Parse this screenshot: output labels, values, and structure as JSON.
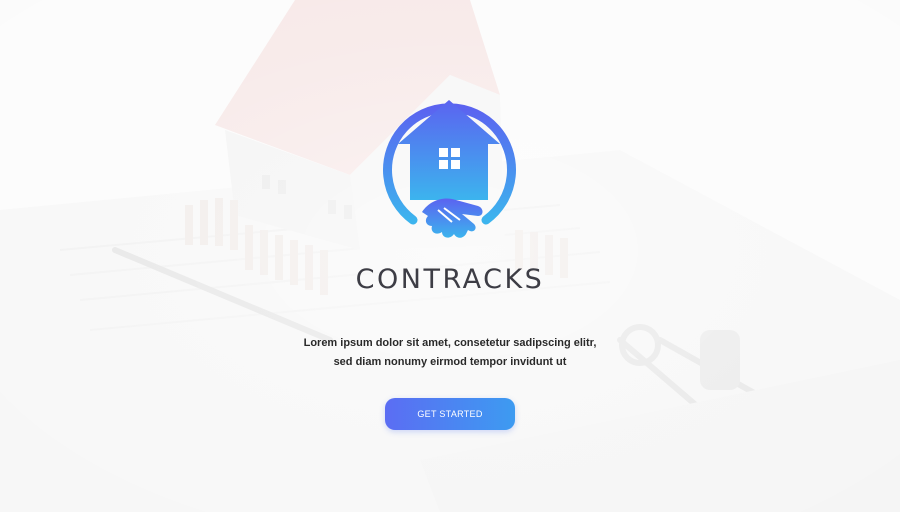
{
  "brand": {
    "name": "CONTRACKS",
    "logo_icon": "house-handshake-icon"
  },
  "hero": {
    "tagline_line1": "Lorem ipsum dolor sit amet, consetetur sadipscing elitr,",
    "tagline_line2": "sed diam nonumy eirmod tempor invidunt ut"
  },
  "cta": {
    "label": "GET STARTED"
  },
  "colors": {
    "gradient_start": "#5b6df3",
    "gradient_end": "#3d9bf1",
    "brand_text": "#3d3d45"
  }
}
